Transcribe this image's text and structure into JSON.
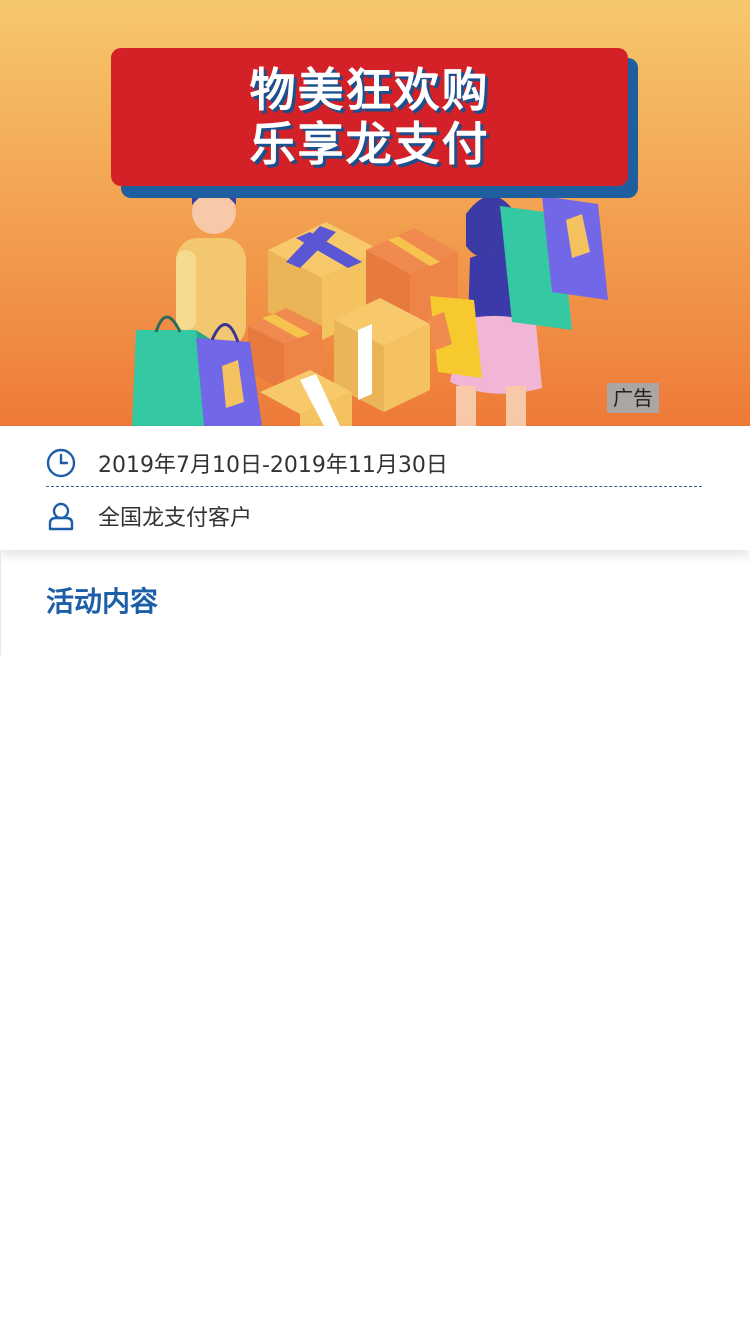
{
  "banner": {
    "title_line1": "物美狂欢购",
    "title_line2": "乐享龙支付",
    "ad_label": "广告",
    "colors": {
      "gradient_top": "#f6c86c",
      "gradient_bottom": "#ee7a38",
      "title_bg": "#d32127",
      "title_shadow": "#1f5fa0"
    }
  },
  "info": {
    "date_icon": "clock-icon",
    "date_range": "2019年7月10日-2019年11月30日",
    "audience_icon": "user-icon",
    "audience": "全国龙支付客户"
  },
  "section": {
    "title": "活动内容"
  }
}
